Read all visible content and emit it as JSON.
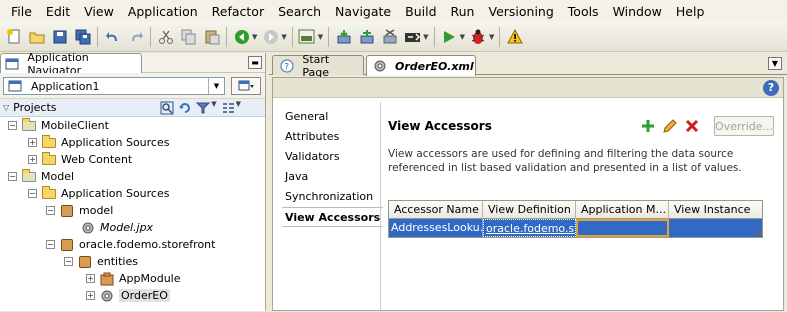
{
  "menu": [
    "File",
    "Edit",
    "View",
    "Application",
    "Refactor",
    "Search",
    "Navigate",
    "Build",
    "Run",
    "Versioning",
    "Tools",
    "Window",
    "Help"
  ],
  "navigator": {
    "title": "Application Navigator",
    "application": "Application1",
    "projects_label": "Projects"
  },
  "tree": {
    "mobileclient": "MobileClient",
    "app_sources_1": "Application Sources",
    "web_content": "Web Content",
    "model": "Model",
    "app_sources_2": "Application Sources",
    "model_pkg": "model",
    "model_jpx": "Model.jpx",
    "storefront": "oracle.fodemo.storefront",
    "entities": "entities",
    "appmodule": "AppModule",
    "ordereo": "OrderEO"
  },
  "tabs": [
    {
      "label": "Start Page"
    },
    {
      "label": "OrderEO.xml"
    }
  ],
  "editor_nav": [
    "General",
    "Attributes",
    "Validators",
    "Java",
    "Synchronization",
    "View Accessors"
  ],
  "section": {
    "title": "View Accessors",
    "override_label": "Override...",
    "description": "View accessors are used for defining and filtering the data source referenced in list based validation and presented in a list of values."
  },
  "table": {
    "headers": [
      "Accessor Name",
      "View Definition",
      "Application M...",
      "View Instance"
    ],
    "rows": [
      [
        "AddressesLooku...",
        "oracle.fodemo.stor",
        "",
        ""
      ]
    ]
  },
  "colors": {
    "selection": "#316ac5",
    "add_green": "#2e9d2e",
    "delete_red": "#cc1f1f",
    "help_blue": "#3d6cb8"
  }
}
